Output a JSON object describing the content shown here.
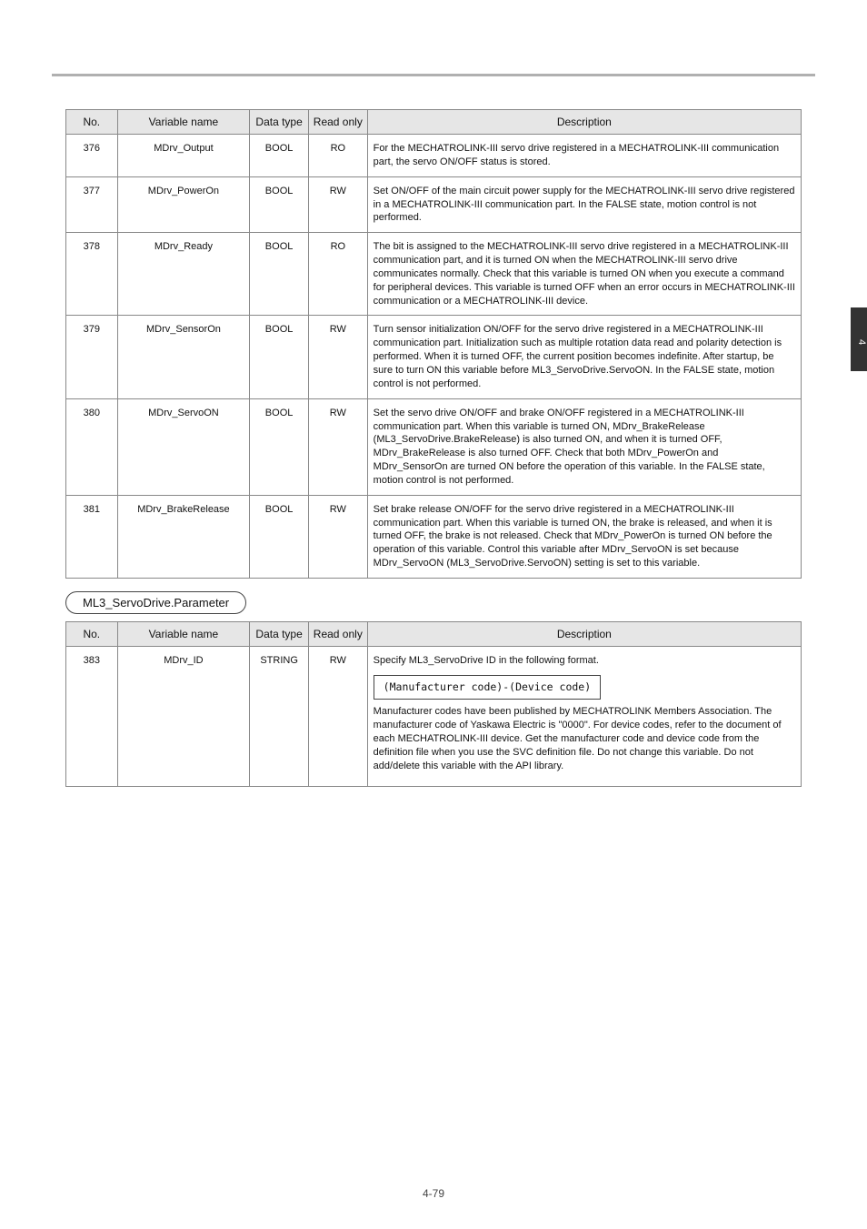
{
  "table1": {
    "head": {
      "no": "No.",
      "name": "Variable name",
      "type": "Data type",
      "ro": "Read only",
      "desc": "Description"
    },
    "rows": [
      {
        "no": "376",
        "name": "MDrv_Output",
        "type": "BOOL",
        "ro": "RO",
        "desc": "For the MECHATROLINK-III servo drive registered in a MECHATROLINK-III communication part, the servo ON/OFF status is stored."
      },
      {
        "no": "377",
        "name": "MDrv_PowerOn",
        "type": "BOOL",
        "ro": "RW",
        "desc": "Set ON/OFF of the main circuit power supply for the MECHATROLINK-III servo drive registered in a MECHATROLINK-III communication part.\nIn the FALSE state, motion control is not performed."
      },
      {
        "no": "378",
        "name": "MDrv_Ready",
        "type": "BOOL",
        "ro": "RO",
        "desc": "The bit is assigned to the MECHATROLINK-III servo drive registered in a MECHATROLINK-III communication part, and it is turned ON when the MECHATROLINK-III servo drive communicates normally.\nCheck that this variable is turned ON when you execute a command for peripheral devices.\nThis variable is turned OFF when an error occurs in MECHATROLINK-III communication or a MECHATROLINK-III device."
      },
      {
        "no": "379",
        "name": "MDrv_SensorOn",
        "type": "BOOL",
        "ro": "RW",
        "desc": "Turn sensor initialization ON/OFF for the servo drive registered in a MECHATROLINK-III communication part. Initialization such as multiple rotation data read and polarity detection is performed.\nWhen it is turned OFF, the current position becomes indefinite.\nAfter startup, be sure to turn ON this variable before ML3_ServoDrive.ServoON.\nIn the FALSE state, motion control is not performed."
      },
      {
        "no": "380",
        "name": "MDrv_ServoON",
        "type": "BOOL",
        "ro": "RW",
        "desc": "Set the servo drive ON/OFF and brake ON/OFF registered in a MECHATROLINK-III communication part.\nWhen this variable is turned ON, MDrv_BrakeRelease (ML3_ServoDrive.BrakeRelease) is also turned ON, and when it is turned OFF, MDrv_BrakeRelease is also turned OFF.\nCheck that both MDrv_PowerOn and MDrv_SensorOn are turned ON before the operation of this variable.\nIn the FALSE state, motion control is not performed."
      },
      {
        "no": "381",
        "name": "MDrv_BrakeRelease",
        "type": "BOOL",
        "ro": "RW",
        "desc": "Set brake release ON/OFF for the servo drive registered in a MECHATROLINK-III communication part.\nWhen this variable is turned ON, the brake is released, and when it is turned OFF, the brake is not released.\nCheck that MDrv_PowerOn is turned ON before the operation of this variable.\nControl this variable after MDrv_ServoON is set because MDrv_ServoON (ML3_ServoDrive.ServoON) setting is set to this variable."
      }
    ]
  },
  "section_head": "ML3_ServoDrive.Parameter",
  "table2": {
    "head": {
      "no": "No.",
      "name": "Variable name",
      "type": "Data type",
      "ro": "Read only",
      "desc": "Description"
    },
    "rows": [
      {
        "no": "383",
        "name": "MDrv_ID",
        "type": "STRING",
        "ro": "RW",
        "box": "(Manufacturer code)-(Device code)",
        "desc_pre": "Specify ML3_ServoDrive ID in the following format.",
        "desc_post": "Manufacturer codes have been published by MECHATROLINK Members Association. The manufacturer code of Yaskawa Electric is \"0000\".\nFor device codes, refer to the document of each MECHATROLINK-III device.\nGet the manufacturer code and device code from the definition file when you use the SVC definition file.\nDo not change this variable.\nDo not add/delete this variable with the API library."
      }
    ]
  },
  "side_tab": "4",
  "footer": "4-79"
}
